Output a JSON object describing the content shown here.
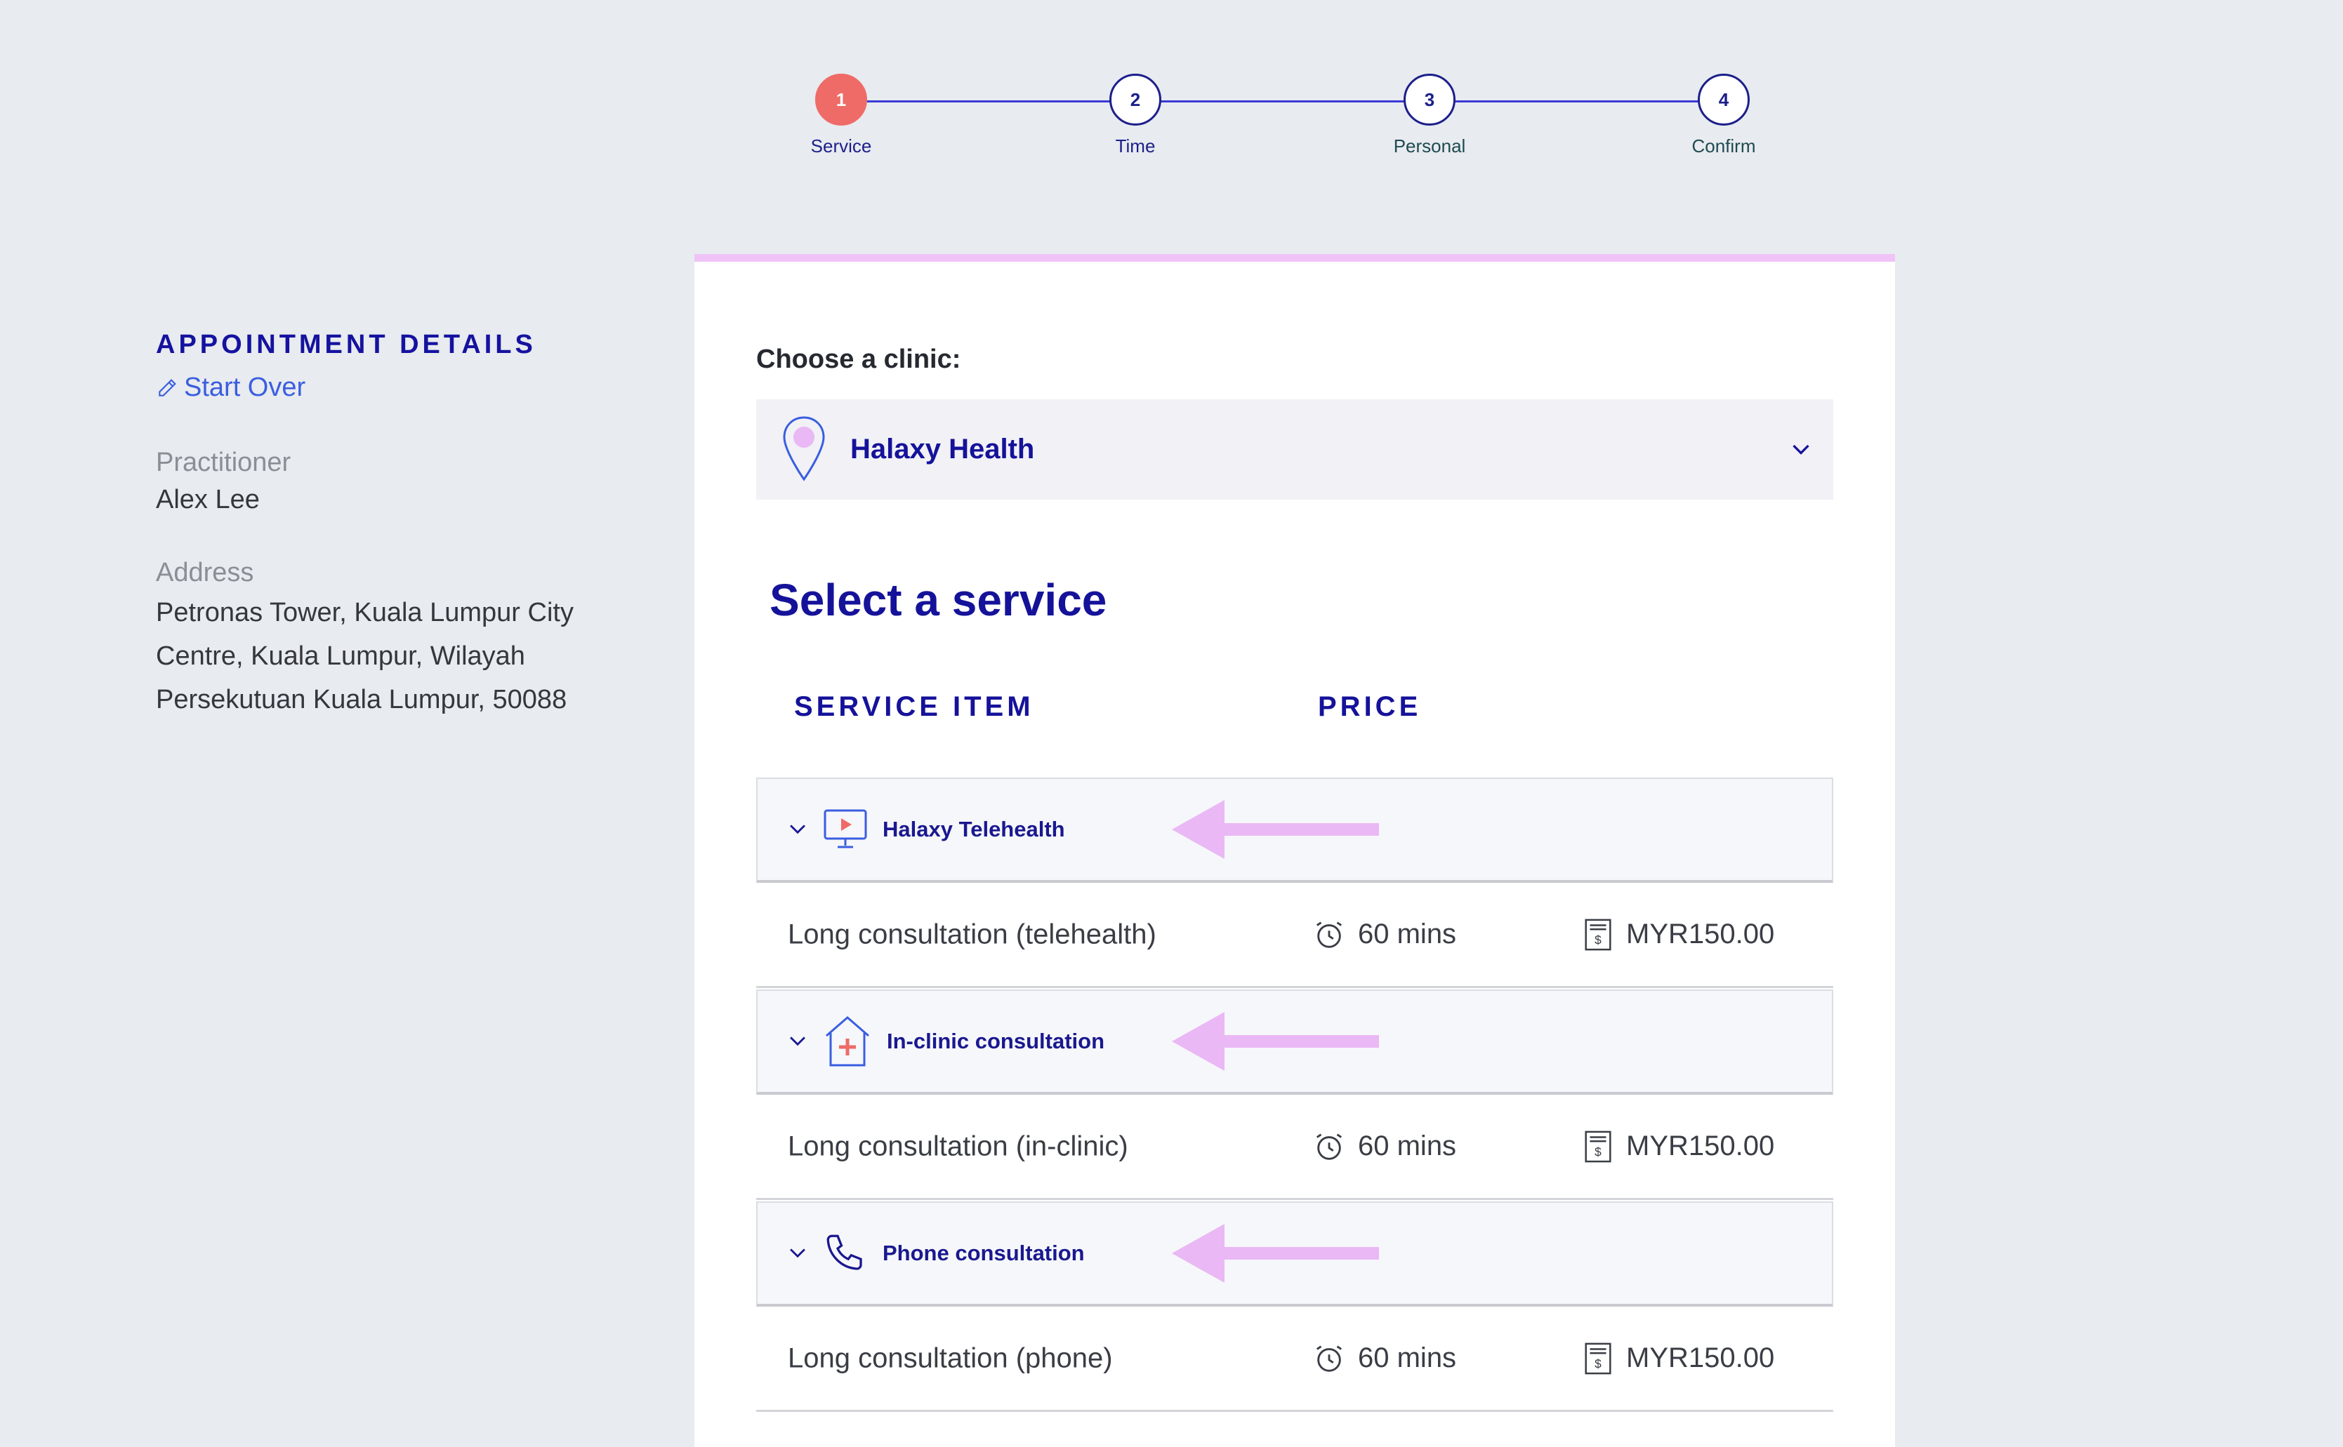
{
  "stepper": {
    "steps": [
      {
        "number": "1",
        "label": "Service"
      },
      {
        "number": "2",
        "label": "Time"
      },
      {
        "number": "3",
        "label": "Personal"
      },
      {
        "number": "4",
        "label": "Confirm"
      }
    ],
    "active_step": 1
  },
  "appointment": {
    "title": "APPOINTMENT DETAILS",
    "start_over": "Start Over",
    "practitioner_label": "Practitioner",
    "practitioner": "Alex Lee",
    "address_label": "Address",
    "address_lines": [
      "Petronas Tower, Kuala Lumpur City",
      "Centre, Kuala Lumpur, Wilayah",
      "Persekutuan Kuala Lumpur, 50088"
    ]
  },
  "clinic": {
    "label": "Choose a clinic:",
    "selected": "Halaxy Health"
  },
  "services": {
    "title": "Select a service",
    "col_service": "SERVICE ITEM",
    "col_price": "PRICE",
    "groups": [
      {
        "label": "Halaxy Telehealth",
        "icon": "telehealth-icon",
        "item": {
          "name": "Long consultation (telehealth)",
          "duration": "60 mins",
          "price": "MYR150.00"
        }
      },
      {
        "label": "In-clinic consultation",
        "icon": "clinic-icon",
        "item": {
          "name": "Long consultation (in-clinic)",
          "duration": "60 mins",
          "price": "MYR150.00"
        }
      },
      {
        "label": "Phone consultation",
        "icon": "phone-icon",
        "item": {
          "name": "Long consultation (phone)",
          "duration": "60 mins",
          "price": "MYR150.00"
        }
      }
    ]
  },
  "colors": {
    "accent_navy": "#15129a",
    "active_step": "#ef6b67",
    "highlight_pink": "#eab8f5",
    "link_blue": "#3a5ee0"
  }
}
